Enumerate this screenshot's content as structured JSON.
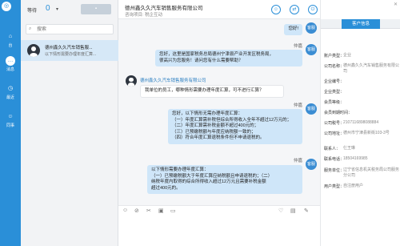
{
  "nav": {
    "items": [
      {
        "label": "台",
        "icon": "home-icon"
      },
      {
        "label": "消息",
        "icon": "chat-icon"
      },
      {
        "label": "最近",
        "icon": "clock-icon"
      },
      {
        "label": "同事",
        "icon": "contacts-icon"
      }
    ]
  },
  "list": {
    "wait_label": "等待",
    "wait_count": "0",
    "search_placeholder": "搜索",
    "session": {
      "name": "德州鑫久久汽车销售服...",
      "preview": "以下情形需要办理年度汇算..."
    }
  },
  "header": {
    "company": "德州鑫久久汽车销售服务有限公司",
    "project": "咨询项目: 税企互动"
  },
  "chat": {
    "messages": [
      {
        "role": "agent",
        "sender": "",
        "text": "您好!"
      },
      {
        "role": "agent",
        "sender": "仲嘉",
        "text": "您好，这里是国家税务总局德州宁津县产业开发区税务局，\n很高兴为您服务！请问您有什么需要帮助？"
      },
      {
        "role": "customer",
        "sender": "德州鑫久久汽车销售服务有限公司",
        "text": "我单位的员工，哪种情形需要办理年度汇算，可不进行汇算？"
      },
      {
        "role": "agent",
        "sender": "仲嘉",
        "text": "您好，以下情形无需办理年度汇算：\n（一）年度汇算需补税但综合所得收入全年不超过12万元的；\n（二）年度汇算需补税金额不超过400元的；\n（三）已预缴税额与年度应纳税额一致的；\n（四）符合年度汇算退税条件但不申请退税的。"
      },
      {
        "role": "agent",
        "sender": "仲嘉",
        "text": "以下情形需要办理年度汇算：\n（一）已预缴税额大于年度汇算应纳税额且申请退税的；（二）\n纳税年度内取得的综合所得收入超过12万元且需要补税金额\n超过400元的。"
      }
    ]
  },
  "sidebar": {
    "tab_label": "客户信息",
    "rows": [
      {
        "key": "账户类型：",
        "value": "企业"
      },
      {
        "key": "公司名称：",
        "value": "德州鑫久久汽车销售服务有限公司"
      },
      {
        "key": "企业编号：",
        "value": ""
      },
      {
        "key": "企业类型：",
        "value": ""
      },
      {
        "key": "会员等级：",
        "value": ""
      },
      {
        "key": "会员到期时间：",
        "value": ""
      },
      {
        "key": "公司税号：",
        "value": "2107116898088884"
      },
      {
        "key": "公司地址：",
        "value": "德州市宁津县新街103-3号"
      },
      {
        "key": "联系人：",
        "value": "仨王琳"
      },
      {
        "key": "联系电话：",
        "value": "18504169985"
      },
      {
        "key": "服务单位：",
        "value": "辽宁省信息机关税务局公司服务分公司"
      },
      {
        "key": "用户类型：",
        "value": "自注册用户"
      }
    ]
  },
  "colors": {
    "accent": "#2a8fd8",
    "agent_bubble": "#cfe6f9"
  }
}
